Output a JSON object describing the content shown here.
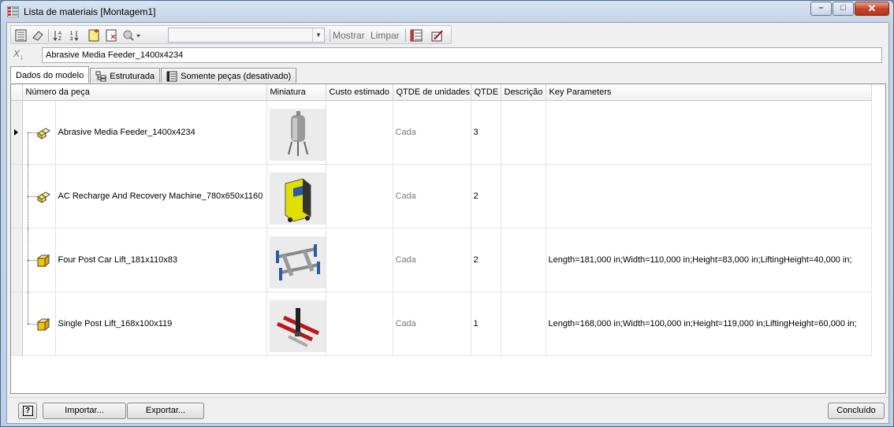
{
  "window": {
    "title": "Lista de materiais [Montagem1]"
  },
  "toolbar": {
    "combo_value": "",
    "show_label": "Mostrar",
    "clear_label": "Limpar"
  },
  "formula": {
    "value": "Abrasive Media Feeder_1400x4234"
  },
  "tabs": [
    {
      "label": "Dados do modelo"
    },
    {
      "label": "Estruturada"
    },
    {
      "label": "Somente peças (desativado)"
    }
  ],
  "grid": {
    "columns": [
      "Número da peça",
      "Miniatura",
      "Custo estimado",
      "QTDE de unidades",
      "QTDE",
      "Descrição",
      "Key Parameters"
    ],
    "rows": [
      {
        "icon": "subassembly-icon",
        "part": "Abrasive Media Feeder_1400x4234",
        "thumb": "feeder-thumbnail",
        "cost": "",
        "unit": "Cada",
        "qty": "3",
        "desc": "",
        "params": ""
      },
      {
        "icon": "subassembly-icon",
        "part": "AC Recharge And Recovery Machine_780x650x1160",
        "thumb": "ac-machine-thumbnail",
        "cost": "",
        "unit": "Cada",
        "qty": "2",
        "desc": "",
        "params": ""
      },
      {
        "icon": "part-icon",
        "part": "Four Post Car Lift_181x110x83",
        "thumb": "four-post-lift-thumbnail",
        "cost": "",
        "unit": "Cada",
        "qty": "2",
        "desc": "",
        "params": "Length=181,000 in;Width=110,000 in;Height=83,000 in;LiftingHeight=40,000 in;"
      },
      {
        "icon": "part-icon",
        "part": "Single Post Lift_168x100x119",
        "thumb": "single-post-lift-thumbnail",
        "cost": "",
        "unit": "Cada",
        "qty": "1",
        "desc": "",
        "params": "Length=168,000 in;Width=100,000 in;Height=119,000 in;LiftingHeight=60,000 in;"
      }
    ]
  },
  "footer": {
    "help_label": "?",
    "import_label": "Importar...",
    "export_label": "Exportar...",
    "done_label": "Concluído"
  },
  "colors": {
    "title_bar": "#c4d4e6",
    "close_button": "#c7452b",
    "subassembly_icon": "#ffd700",
    "part_icon": "#f5c400"
  }
}
